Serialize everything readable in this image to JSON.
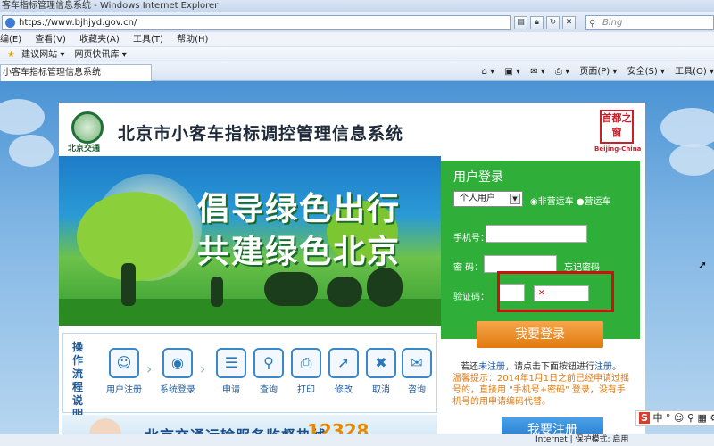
{
  "window": {
    "title": "客车指标管理信息系统 - Windows Internet Explorer",
    "url": "https://www.bjhjyd.gov.cn/",
    "search_placeholder": "Bing"
  },
  "menu": [
    "编(E)",
    "查看(V)",
    "收藏夹(A)",
    "工具(T)",
    "帮助(H)"
  ],
  "favorites": [
    "建议网站 ▾",
    "网页快讯库 ▾"
  ],
  "tab": {
    "label": "小客车指标管理信息系统"
  },
  "commandbar": [
    "页面(P) ▾",
    "安全(S) ▾",
    "工具(O) ▾"
  ],
  "header": {
    "logo_text": "北京交通",
    "title": "北京市小客车指标调控管理信息系统",
    "seal_text": "首都之窗",
    "seal_sub": "Beijing-China"
  },
  "banner": {
    "line1": "倡导绿色出行",
    "line2": "共建绿色北京"
  },
  "process": {
    "label": "操作流程说明",
    "steps": [
      {
        "label": "用户注册",
        "icon": "user-icon",
        "glyph": "☺"
      },
      {
        "label": "系统登录",
        "icon": "mouse-icon",
        "glyph": "◉"
      },
      {
        "label": "申请",
        "icon": "document-icon",
        "glyph": "☰"
      },
      {
        "label": "查询",
        "icon": "search-icon",
        "glyph": "⚲"
      },
      {
        "label": "打印",
        "icon": "printer-icon",
        "glyph": "⎙"
      },
      {
        "label": "修改",
        "icon": "cursor-icon",
        "glyph": "➚"
      },
      {
        "label": "取消",
        "icon": "cancel-icon",
        "glyph": "✖"
      },
      {
        "label": "咨询",
        "icon": "chat-icon",
        "glyph": "✉"
      }
    ]
  },
  "hotline": {
    "text": "北京交通运输服务监督热线",
    "number": "12328"
  },
  "login": {
    "title": "用户登录",
    "user_type": "个人用户",
    "radio1": "非营运车",
    "radio2": "营运车",
    "phone_label": "手机号：",
    "password_label": "密  码：",
    "forgot": "忘记密码",
    "captcha_label": "验证码：",
    "login_button": "我要登录",
    "reg_hint_pre": "若还",
    "reg_hint_link1": "未注册",
    "reg_hint_mid": "，请点击下面按钮进行",
    "reg_hint_link2": "注册",
    "reg_hint_end": "。",
    "warning": "温馨提示：2014年1月1日之前已经申请过摇号的，直接用 \"手机号+密码\" 登录，没有手机号的用申请编码代替。",
    "register_button": "我要注册"
  },
  "status": {
    "zone": "Internet | 保护模式: 启用"
  },
  "ime": {
    "text": "中 ° ☺ ⚲ ▦ ⚙"
  }
}
